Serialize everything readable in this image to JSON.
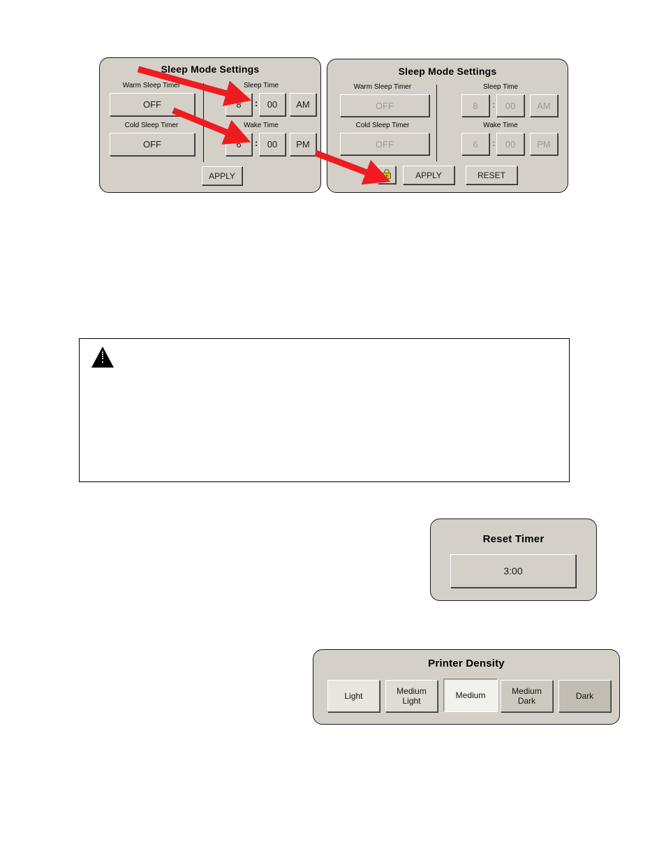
{
  "sleep_panel_enabled": {
    "title": "Sleep Mode Settings",
    "warm_label": "Warm Sleep Timer",
    "warm_value": "OFF",
    "cold_label": "Cold Sleep Timer",
    "cold_value": "OFF",
    "sleep_time_label": "Sleep Time",
    "sleep_hour": "8",
    "sleep_colon": ":",
    "sleep_minute": "00",
    "sleep_meridiem": "AM",
    "wake_time_label": "Wake Time",
    "wake_hour": "6",
    "wake_colon": ":",
    "wake_minute": "00",
    "wake_meridiem": "PM",
    "apply_label": "APPLY"
  },
  "sleep_panel_locked": {
    "title": "Sleep Mode Settings",
    "warm_label": "Warm Sleep Timer",
    "warm_value": "OFF",
    "cold_label": "Cold Sleep Timer",
    "cold_value": "OFF",
    "sleep_time_label": "Sleep Time",
    "sleep_hour": "8",
    "sleep_colon": ":",
    "sleep_minute": "00",
    "sleep_meridiem": "AM",
    "wake_time_label": "Wake Time",
    "wake_hour": "6",
    "wake_colon": ":",
    "wake_minute": "00",
    "wake_meridiem": "PM",
    "lock_icon": "padlock-icon",
    "apply_label": "APPLY",
    "reset_label": "RESET"
  },
  "callouts": [
    {
      "name": "arrow-to-sleep-hour"
    },
    {
      "name": "arrow-to-wake-hour"
    },
    {
      "name": "arrow-to-lock-button"
    }
  ],
  "note_box": {
    "icon": "warning-triangle-icon",
    "text": ""
  },
  "reset_timer_panel": {
    "title": "Reset Timer",
    "value": "3:00"
  },
  "printer_density_panel": {
    "title": "Printer Density",
    "options": [
      {
        "label_line1": "Light",
        "label_line2": "",
        "color": "#e8e6de",
        "selected": false
      },
      {
        "label_line1": "Medium",
        "label_line2": "Light",
        "color": "#dedcd4",
        "selected": false
      },
      {
        "label_line1": "Medium",
        "label_line2": "",
        "color": "#f2f1ec",
        "selected": true
      },
      {
        "label_line1": "Medium",
        "label_line2": "Dark",
        "color": "#cec9bf",
        "selected": false
      },
      {
        "label_line1": "Dark",
        "label_line2": "",
        "color": "#c2bdb2",
        "selected": false
      }
    ]
  },
  "colors": {
    "panel_bg": "#d4d0c8",
    "arrow_red": "#ee1c20",
    "lock_gold": "#b5b52a",
    "disabled_text": "#9a9a96"
  }
}
